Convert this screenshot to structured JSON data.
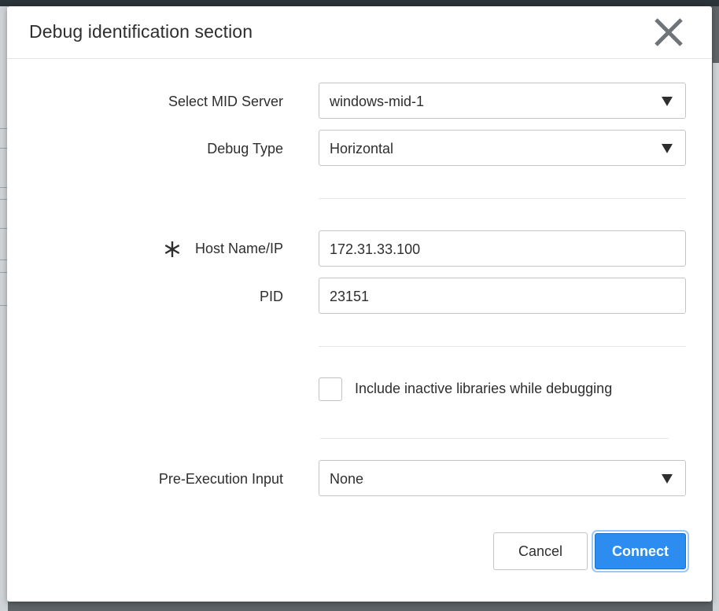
{
  "dialog": {
    "title": "Debug identification section",
    "close_icon": "close-icon"
  },
  "form": {
    "mid_server": {
      "label": "Select MID Server",
      "value": "windows-mid-1"
    },
    "debug_type": {
      "label": "Debug Type",
      "value": "Horizontal"
    },
    "host": {
      "label": "Host Name/IP",
      "value": "172.31.33.100",
      "required": true
    },
    "pid": {
      "label": "PID",
      "value": "23151"
    },
    "include_inactive": {
      "label": "Include inactive libraries while debugging",
      "checked": false
    },
    "pre_execution": {
      "label": "Pre-Execution Input",
      "value": "None"
    }
  },
  "buttons": {
    "cancel": "Cancel",
    "connect": "Connect"
  },
  "colors": {
    "primary": "#2d8cf0",
    "backdrop": "#5e6468"
  }
}
